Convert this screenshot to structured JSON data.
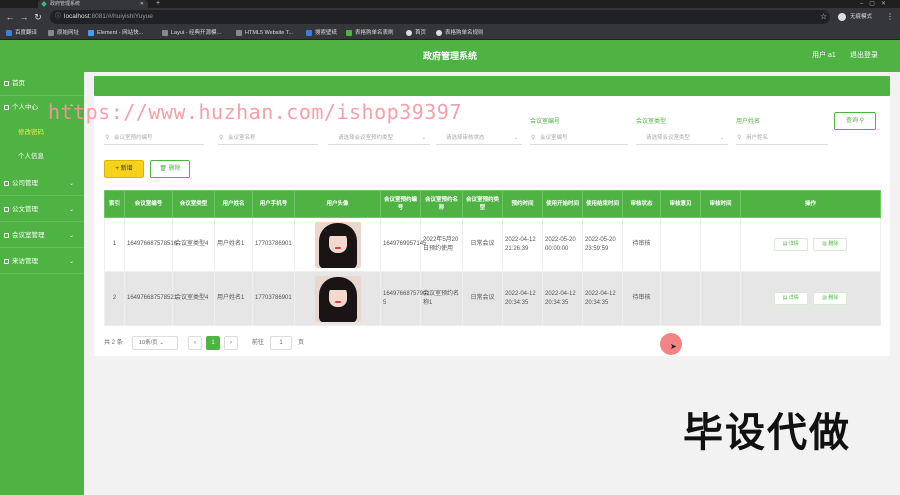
{
  "browser": {
    "tab_title": "政府管理系统",
    "url_host": "localhost",
    "url_path": ":8081/#/huiyishiYuyue",
    "profile_name": "无痕模式",
    "bookmarks": [
      "百度翻译",
      "原始网址",
      "Element - 网站快...",
      "Layui - 经典开源模...",
      "HTML5 Website T...",
      "搜索壁纸",
      "表格购单名表刷",
      "首页",
      "表格购单名规则"
    ]
  },
  "header": {
    "title": "政府管理系统",
    "user": "用户 a1",
    "logout": "退出登录"
  },
  "sidebar": {
    "items": [
      {
        "label": "首页"
      },
      {
        "label": "个人中心"
      },
      {
        "label": "修改密码"
      },
      {
        "label": "个人信息"
      },
      {
        "label": "公司管理"
      },
      {
        "label": "公文管理"
      },
      {
        "label": "会议室管理"
      },
      {
        "label": "来访管理"
      }
    ]
  },
  "filters": {
    "labels": [
      "会议室编号",
      "会议室类型",
      "用户姓名"
    ],
    "placeholders": [
      "会议室预约编号",
      "会议室名称",
      "请选择会议室预约类型",
      "请选择审核状态",
      "会议室编号",
      "请选择会议室类型",
      "用户姓名"
    ],
    "query_button": "查询"
  },
  "actions": {
    "add": "+ 新增",
    "delete": "删除"
  },
  "table": {
    "headers": [
      "索引",
      "会议室编号",
      "会议室类型",
      "用户姓名",
      "用户手机号",
      "用户头像",
      "会议室预约编号",
      "会议室预约名称",
      "会议室预约类型",
      "预约时间",
      "使用开始时间",
      "使用结束时间",
      "审核状态",
      "审核意见",
      "审核时间",
      "操作"
    ],
    "rows": [
      {
        "index": "1",
        "room_no": "164976687578516",
        "room_type": "会议室类型4",
        "user_name": "用户姓名1",
        "phone": "17703786901",
        "booking_no": "1649769957145",
        "booking_name": "2022年5月20日预约使用",
        "booking_type": "日常会议",
        "booked_at": "2022-04-12 21:26:39",
        "start": "2022-05-20 00:00:00",
        "end": "2022-05-20 23:59:59",
        "status": "待审核",
        "opinion": "",
        "review_time": ""
      },
      {
        "index": "2",
        "room_no": "164976687578521",
        "room_type": "会议室类型4",
        "user_name": "用户姓名1",
        "phone": "17703786901",
        "booking_no": "16497668757901 5",
        "booking_name": "会议室预约名称1",
        "booking_type": "日常会议",
        "booked_at": "2022-04-12 20:34:35",
        "start": "2022-04-12 20:34:35",
        "end": "2022-04-12 20:34:35",
        "status": "待审核",
        "opinion": "",
        "review_time": ""
      }
    ],
    "op_detail": "详情",
    "op_delete": "删除"
  },
  "pager": {
    "total": "共 2 条",
    "page_size": "10条/页",
    "prev": "‹",
    "current": "1",
    "next": "›",
    "goto_label": "前往",
    "goto_value": "1",
    "page_unit": "页"
  },
  "overlay": {
    "watermark": "https://www.huzhan.com/ishop39397",
    "promo": "毕设代做"
  }
}
